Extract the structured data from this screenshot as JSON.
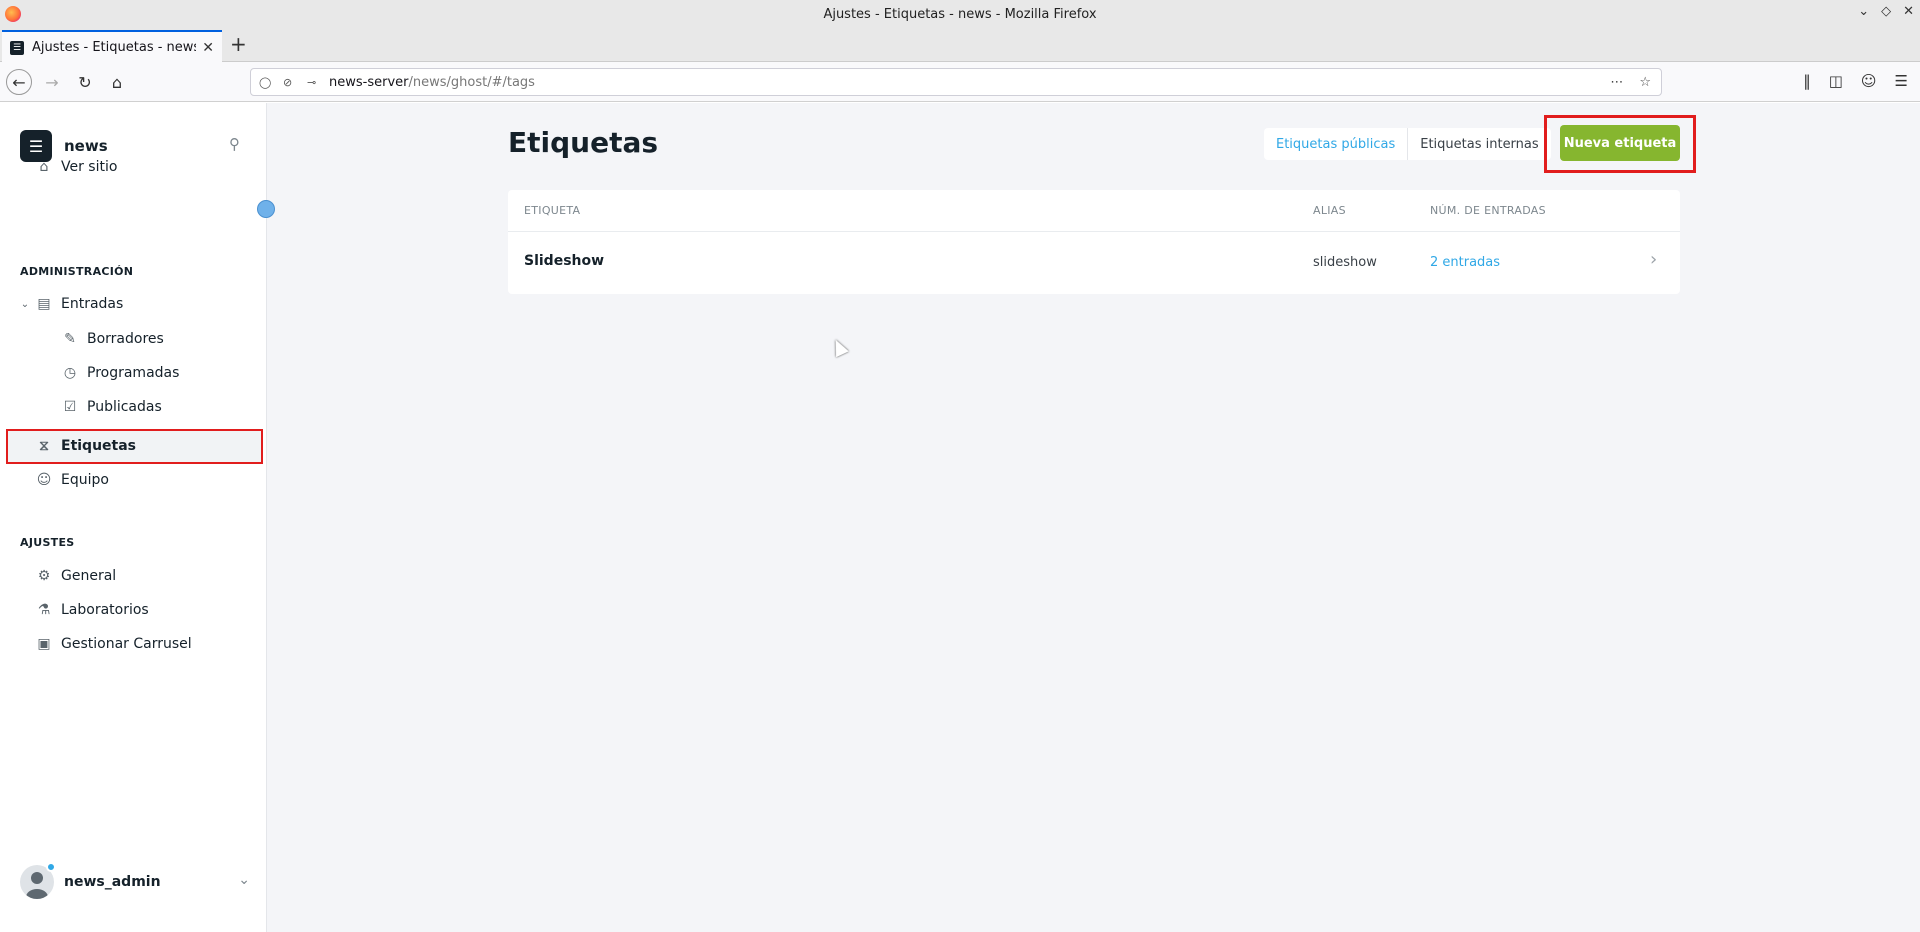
{
  "window": {
    "title": "Ajustes - Etiquetas - news - Mozilla Firefox"
  },
  "browser": {
    "tab_title": "Ajustes - Etiquetas - news",
    "url_host": "news-server",
    "url_path": "/news/ghost/#/tags"
  },
  "sidebar": {
    "brand_name": "news",
    "view_site": "Ver sitio",
    "section_admin": "ADMINISTRACIÓN",
    "posts": "Entradas",
    "drafts": "Borradores",
    "scheduled": "Programadas",
    "published": "Publicadas",
    "tags": "Etiquetas",
    "staff": "Equipo",
    "section_settings": "AJUSTES",
    "general": "General",
    "labs": "Laboratorios",
    "carousel": "Gestionar Carrusel",
    "username": "news_admin"
  },
  "main": {
    "title": "Etiquetas",
    "filter_public": "Etiquetas públicas",
    "filter_internal": "Etiquetas internas",
    "new_tag": "Nueva etiqueta",
    "columns": {
      "tag": "ETIQUETA",
      "slug": "ALIAS",
      "count": "NÚM. DE ENTRADAS"
    },
    "rows": [
      {
        "name": "Slideshow",
        "slug": "slideshow",
        "count": "2 entradas"
      }
    ]
  },
  "colors": {
    "accent": "#30a8e6",
    "primary_button": "#86b62f",
    "highlight": "#e11d1d"
  }
}
